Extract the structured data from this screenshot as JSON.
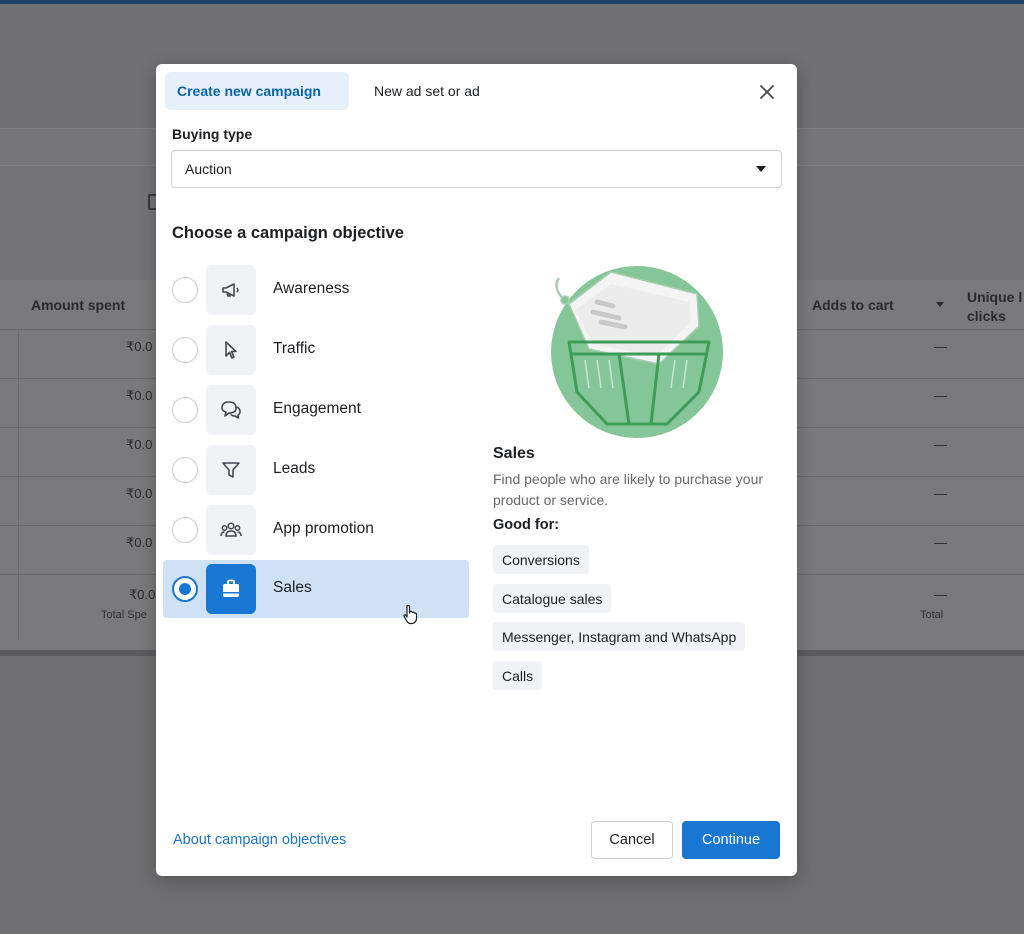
{
  "background": {
    "columns": {
      "amount_spent": "Amount spent",
      "adds_to_cart": "Adds to cart",
      "unique_clicks": "Unique l clicks"
    },
    "rows": [
      {
        "amount": "₹0.0",
        "adds": "—"
      },
      {
        "amount": "₹0.0",
        "adds": "—"
      },
      {
        "amount": "₹0.0",
        "adds": "—"
      },
      {
        "amount": "₹0.0",
        "adds": "—"
      },
      {
        "amount": "₹0.0",
        "adds": "—"
      }
    ],
    "totals": {
      "amount": "₹0.0",
      "amount_label": "Total Spe",
      "adds": "—",
      "adds_label": "Total"
    }
  },
  "modal": {
    "tabs": {
      "active": "Create new campaign",
      "inactive": "New ad set or ad"
    },
    "close_icon": "close-icon",
    "buying_type": {
      "label": "Buying type",
      "value": "Auction"
    },
    "section_title": "Choose a campaign objective",
    "objectives": [
      {
        "label": "Awareness",
        "icon": "megaphone-icon",
        "selected": false
      },
      {
        "label": "Traffic",
        "icon": "cursor-icon",
        "selected": false
      },
      {
        "label": "Engagement",
        "icon": "chat-bubbles-icon",
        "selected": false
      },
      {
        "label": "Leads",
        "icon": "funnel-icon",
        "selected": false
      },
      {
        "label": "App promotion",
        "icon": "people-icon",
        "selected": false
      },
      {
        "label": "Sales",
        "icon": "shopping-bag-icon",
        "selected": true
      }
    ],
    "detail": {
      "title": "Sales",
      "description": "Find people who are likely to purchase your product or service.",
      "good_for_label": "Good for:",
      "good_for": [
        "Conversions",
        "Catalogue sales",
        "Messenger, Instagram and WhatsApp",
        "Calls"
      ]
    },
    "footer": {
      "link": "About campaign objectives",
      "cancel": "Cancel",
      "continue": "Continue"
    }
  },
  "colors": {
    "accent": "#1877d2",
    "selected_bg": "#cfe1f5",
    "link": "#1b74c5",
    "illustration_green": "#84c697"
  }
}
